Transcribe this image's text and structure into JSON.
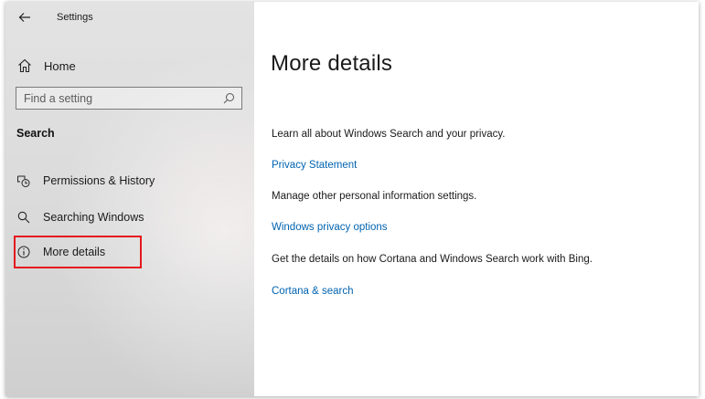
{
  "window": {
    "title": "Settings"
  },
  "sidebar": {
    "home_label": "Home",
    "search_placeholder": "Find a setting",
    "section_header": "Search",
    "items": [
      {
        "label": "Permissions & History",
        "icon": "permissions-history-icon"
      },
      {
        "label": "Searching Windows",
        "icon": "search-icon"
      },
      {
        "label": "More details",
        "icon": "info-icon",
        "selected": true
      }
    ]
  },
  "main": {
    "title": "More details",
    "blocks": [
      {
        "text": "Learn all about Windows Search and your privacy.",
        "link": "Privacy Statement"
      },
      {
        "text": "Manage other personal information settings.",
        "link": "Windows privacy options"
      },
      {
        "text": "Get the details on how Cortana and Windows Search work with Bing.",
        "link": "Cortana & search"
      }
    ]
  },
  "colors": {
    "link": "#0063b1",
    "highlight_box": "#e5181e"
  }
}
